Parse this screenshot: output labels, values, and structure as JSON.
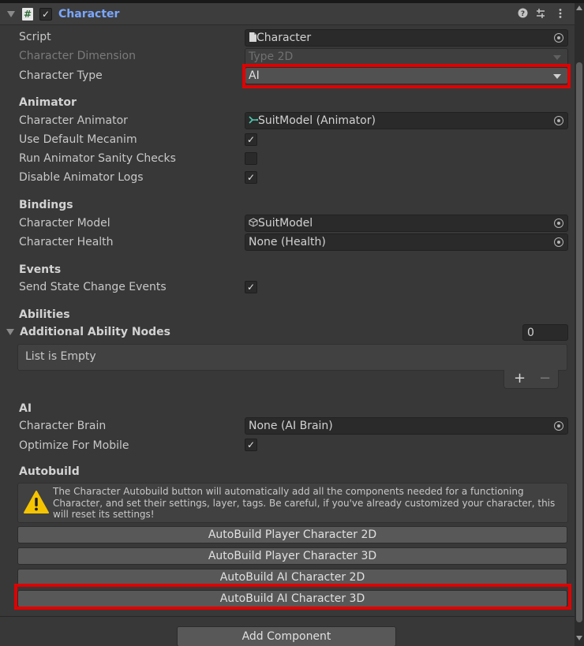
{
  "header": {
    "title": "Character",
    "enabled_mark": "✓",
    "script_glyph": "#"
  },
  "script": {
    "label": "Script",
    "value": "Character"
  },
  "character_dimension": {
    "label": "Character Dimension",
    "value": "Type 2D"
  },
  "character_type": {
    "label": "Character Type",
    "value": "AI"
  },
  "animator": {
    "section": "Animator",
    "character_animator_label": "Character Animator",
    "character_animator_value": "SuitModel (Animator)",
    "use_default_mecanim_label": "Use Default Mecanim",
    "use_default_mecanim": "✓",
    "sanity_checks_label": "Run Animator Sanity Checks",
    "sanity_checks": "",
    "disable_logs_label": "Disable Animator Logs",
    "disable_logs": "✓"
  },
  "bindings": {
    "section": "Bindings",
    "model_label": "Character Model",
    "model_value": "SuitModel",
    "health_label": "Character Health",
    "health_value": "None (Health)"
  },
  "events": {
    "section": "Events",
    "send_state_label": "Send State Change Events",
    "send_state": "✓"
  },
  "abilities": {
    "section": "Abilities",
    "nodes_label": "Additional Ability Nodes",
    "nodes_count": "0",
    "empty_text": "List is Empty",
    "add_symbol": "+",
    "remove_symbol": "−"
  },
  "ai": {
    "section": "AI",
    "brain_label": "Character Brain",
    "brain_value": "None (AI Brain)",
    "optimize_label": "Optimize For Mobile",
    "optimize": "✓"
  },
  "autobuild": {
    "section": "Autobuild",
    "help_text": "The Character Autobuild button will automatically add all the components needed for a functioning Character, and set their settings, layer, tags. Be careful, if you've already customized your character, this will reset its settings!",
    "buttons": [
      "AutoBuild Player Character 2D",
      "AutoBuild Player Character 3D",
      "AutoBuild AI Character 2D",
      "AutoBuild AI Character 3D"
    ]
  },
  "add_component": "Add Component",
  "colors": {
    "highlight": "#e00000",
    "title": "#7aa7ff",
    "panel": "#383838"
  }
}
